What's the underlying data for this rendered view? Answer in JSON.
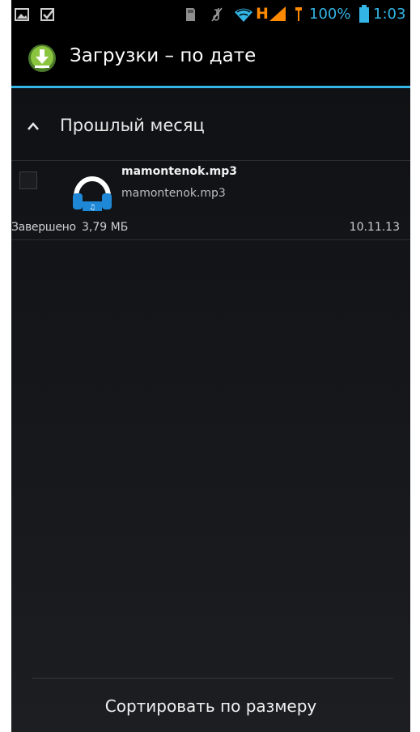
{
  "status_bar": {
    "battery_percent": "100%",
    "time": "1:03",
    "network_label": "H",
    "icons": [
      "image-icon",
      "checkbox-notification-icon",
      "sd-card-icon",
      "muted-icon",
      "wifi-icon",
      "signal-icon",
      "usb-icon",
      "battery-icon"
    ]
  },
  "action_bar": {
    "title": "Загрузки – по дате",
    "icon": "download-icon"
  },
  "section": {
    "title": "Прошлый месяц",
    "icon": "chevron-up-icon"
  },
  "downloads": [
    {
      "filename": "mamontenok.mp3",
      "subtitle": "mamontenok.mp3",
      "status": "Завершено",
      "size": "3,79 МБ",
      "date": "10.11.13",
      "icon": "headphones-audio-icon"
    }
  ],
  "bottom": {
    "sort_label": "Сортировать по размеру"
  },
  "colors": {
    "accent": "#33b5e5",
    "background": "#000000",
    "network_orange": "#ff8a00"
  }
}
